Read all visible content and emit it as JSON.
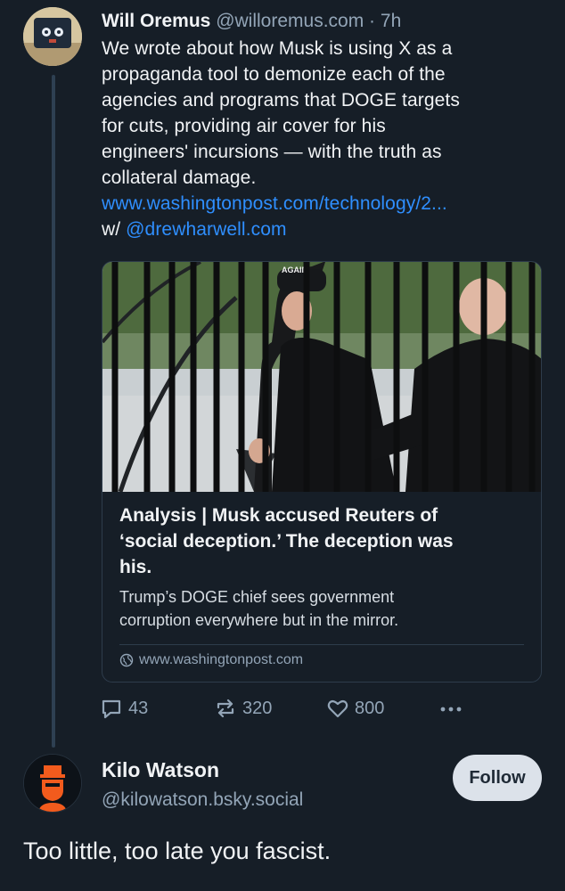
{
  "post": {
    "author_name": "Will Oremus",
    "handle": "@willoremus.com",
    "separator": "·",
    "time": "7h",
    "text_lines": [
      "We wrote about how Musk is using X as a",
      "propaganda tool to demonize each of the",
      "agencies and programs that DOGE targets",
      "for cuts, providing air cover for his",
      "engineers' incursions — with the truth as",
      "collateral damage."
    ],
    "link_text": "www.washingtonpost.com/technology/2...",
    "with_prefix": "w/",
    "mention": "@drewharwell.com",
    "card": {
      "title_lines": [
        "Analysis | Musk accused Reuters of",
        "‘social deception.’ The deception was",
        "his."
      ],
      "description_lines": [
        "Trump’s DOGE chief sees government",
        "corruption everywhere but in the mirror."
      ],
      "domain": "www.washingtonpost.com",
      "image_hat_text": "AGAIN"
    },
    "actions": {
      "replies": "43",
      "reposts": "320",
      "likes": "800"
    }
  },
  "reply": {
    "author_name": "Kilo Watson",
    "handle": "@kilowatson.bsky.social",
    "follow_label": "Follow",
    "text": "Too little, too late you fascist."
  },
  "colors": {
    "background": "#161e27",
    "link": "#2f8fff",
    "muted": "#93a5b7",
    "avatar_accent": "#f25b1d"
  }
}
